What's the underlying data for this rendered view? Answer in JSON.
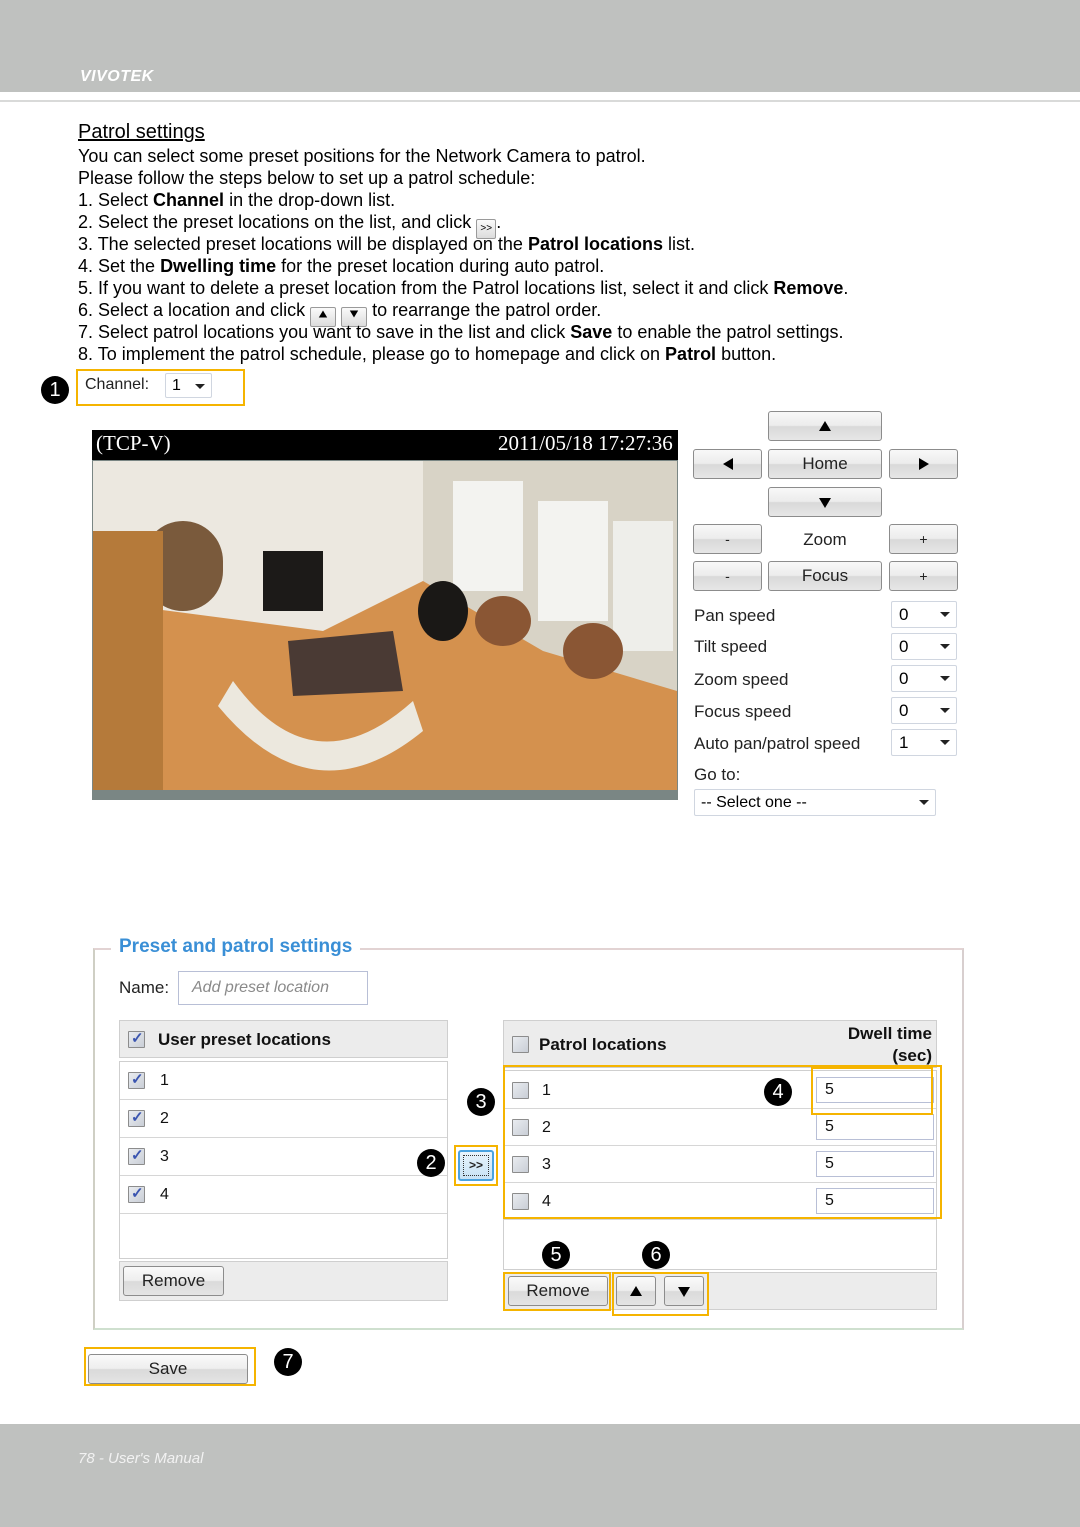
{
  "header": {
    "brand": "VIVOTEK"
  },
  "footer": {
    "page_label": "78 - User's Manual"
  },
  "section": {
    "title": "Patrol settings",
    "intro": [
      "You can select some preset positions for the Network Camera to patrol.",
      "Please follow the steps below to set up a patrol schedule:"
    ],
    "steps": [
      {
        "n": "1. ",
        "pre": "Select ",
        "bold": "Channel",
        "post": " in the drop-down list."
      },
      {
        "n": "2. ",
        "pre": "Select the preset locations on the list, and click ",
        "icon": ">>",
        "post": "."
      },
      {
        "n": "3. ",
        "pre": "The selected preset locations will be displayed on the ",
        "bold": "Patrol locations",
        "post": " list."
      },
      {
        "n": "4. ",
        "pre": "Set the ",
        "bold": "Dwelling time",
        "post": " for the preset location during auto patrol."
      },
      {
        "n": "5. ",
        "pre": "If you want to delete a preset location from the Patrol locations list, select it and click ",
        "bold": "Remove",
        "post": "."
      },
      {
        "n": "6. ",
        "pre": "Select a location and click ",
        "post": " to rearrange the patrol order."
      },
      {
        "n": "7. ",
        "pre": "Select patrol locations you want to save in the list and click ",
        "bold": "Save",
        "post": " to enable the patrol settings."
      },
      {
        "n": "8. ",
        "pre": "To implement  the patrol schedule, please go to homepage and click on ",
        "bold": "Patrol",
        "post": " button."
      }
    ]
  },
  "callouts": [
    "1",
    "2",
    "3",
    "4",
    "5",
    "6",
    "7"
  ],
  "channel": {
    "label": "Channel:",
    "value": "1"
  },
  "camera": {
    "title": "(TCP-V)",
    "timestamp": "2011/05/18 17:27:36"
  },
  "ptz": {
    "home": "Home",
    "zoom_label": "Zoom",
    "focus_label": "Focus",
    "minus": "-",
    "plus": "+",
    "speeds": [
      {
        "label": "Pan speed",
        "value": "0"
      },
      {
        "label": "Tilt speed",
        "value": "0"
      },
      {
        "label": "Zoom speed",
        "value": "0"
      },
      {
        "label": "Focus speed",
        "value": "0"
      },
      {
        "label": "Auto pan/patrol speed",
        "value": "1"
      }
    ],
    "goto_label": "Go to:",
    "goto_value": "-- Select one --"
  },
  "preset": {
    "legend": "Preset and patrol settings",
    "name_label": "Name:",
    "name_placeholder": "Add preset location",
    "user_list_header": "User preset locations",
    "user_items": [
      {
        "label": "1",
        "checked": true
      },
      {
        "label": "2",
        "checked": true
      },
      {
        "label": "3",
        "checked": true
      },
      {
        "label": "4",
        "checked": true
      }
    ],
    "remove_label": "Remove",
    "add_button": ">>",
    "patrol_header": "Patrol locations",
    "dwell_header_1": "Dwell time",
    "dwell_header_2": "(sec)",
    "patrol_items": [
      {
        "label": "1",
        "dwell": "5"
      },
      {
        "label": "2",
        "dwell": "5"
      },
      {
        "label": "3",
        "dwell": "5"
      },
      {
        "label": "4",
        "dwell": "5"
      }
    ],
    "patrol_remove_label": "Remove",
    "save_label": "Save"
  },
  "colors": {
    "highlight": "#f5b400",
    "legend": "#3a8fd6",
    "band": "#bfc1bf"
  }
}
